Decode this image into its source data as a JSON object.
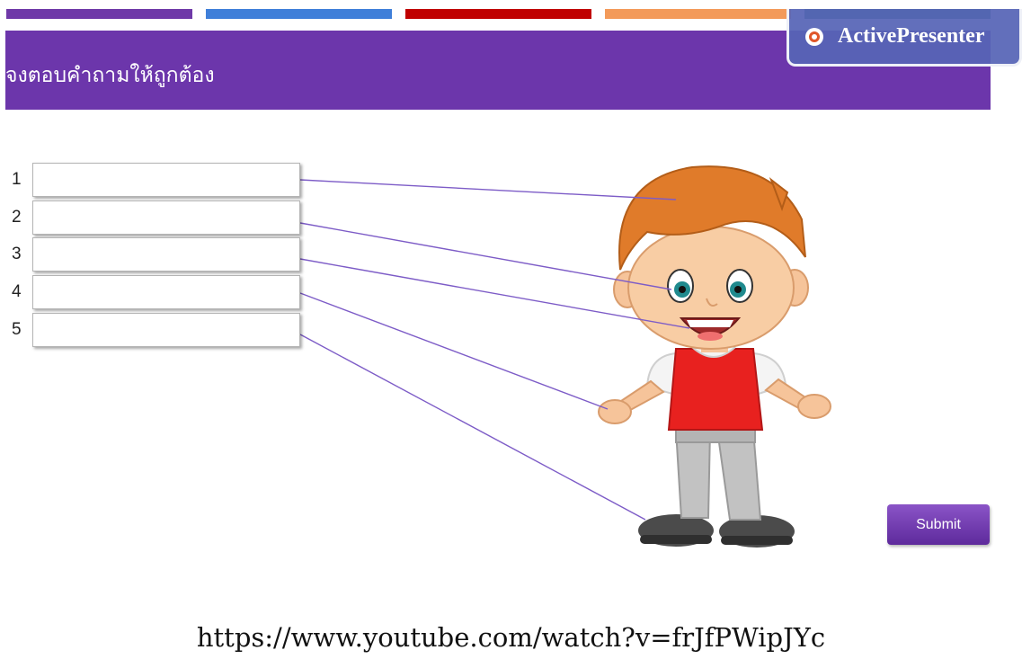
{
  "colors": {
    "bars": [
      "#6f39a8",
      "#3f7fd9",
      "#c00000",
      "#f39a5a",
      "#2e7a6c"
    ],
    "header_bg": "#6c36ab",
    "accent": "#6c36ab",
    "line": "#7d5cc7"
  },
  "header": {
    "title": "จงตอบคำถามให้ถูกต้อง"
  },
  "watermark": {
    "logo_icon": "activepresenter-logo-icon",
    "text": "ActivePresenter"
  },
  "quiz": {
    "items": [
      {
        "number": "1",
        "value": "",
        "placeholder": ""
      },
      {
        "number": "2",
        "value": "",
        "placeholder": ""
      },
      {
        "number": "3",
        "value": "",
        "placeholder": ""
      },
      {
        "number": "4",
        "value": "",
        "placeholder": ""
      },
      {
        "number": "5",
        "value": "",
        "placeholder": ""
      }
    ],
    "submit_label": "Submit"
  },
  "illustration": {
    "subject": "cartoon-boy",
    "targets": [
      "hair",
      "eye",
      "mouth",
      "hand",
      "shoe"
    ]
  },
  "caption": {
    "url": "https://www.youtube.com/watch?v=frJfPWipJYc"
  }
}
